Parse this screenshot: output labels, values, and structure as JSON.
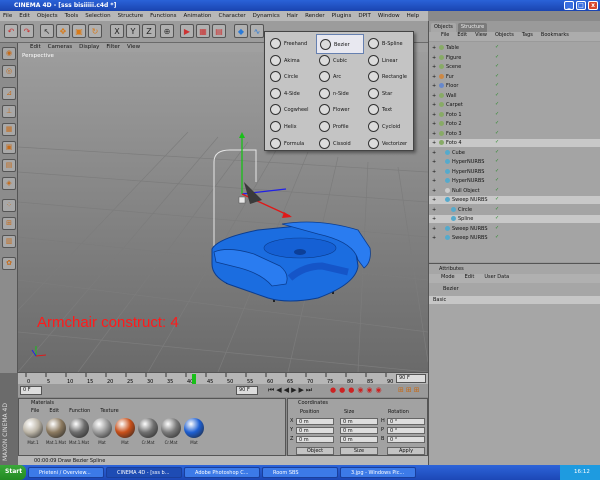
{
  "window": {
    "title": "CINEMA 4D - [sss bisiiiii.c4d *]"
  },
  "menu": [
    "File",
    "Edit",
    "Objects",
    "Tools",
    "Selection",
    "Structure",
    "Functions",
    "Animation",
    "Character",
    "Dynamics",
    "Hair",
    "Render",
    "Plugins",
    "DPIT",
    "Window",
    "Help"
  ],
  "viewport": {
    "menu": [
      "Edit",
      "Cameras",
      "Display",
      "Filter",
      "View"
    ],
    "label": "Perspective",
    "annotation": "Armchair construct: 4"
  },
  "spline_menu": [
    {
      "label": "Freehand",
      "sel": false
    },
    {
      "label": "Bezier",
      "sel": true
    },
    {
      "label": "B-Spline",
      "sel": false
    },
    {
      "label": "Akima",
      "sel": false
    },
    {
      "label": "Cubic",
      "sel": false
    },
    {
      "label": "Linear",
      "sel": false
    },
    {
      "label": "Circle",
      "sel": false
    },
    {
      "label": "Arc",
      "sel": false
    },
    {
      "label": "Rectangle",
      "sel": false
    },
    {
      "label": "4-Side",
      "sel": false
    },
    {
      "label": "n-Side",
      "sel": false
    },
    {
      "label": "Star",
      "sel": false
    },
    {
      "label": "Cogwheel",
      "sel": false
    },
    {
      "label": "Flower",
      "sel": false
    },
    {
      "label": "Text",
      "sel": false
    },
    {
      "label": "Helix",
      "sel": false
    },
    {
      "label": "Profile",
      "sel": false
    },
    {
      "label": "Cycloid",
      "sel": false
    },
    {
      "label": "Formula",
      "sel": false
    },
    {
      "label": "Cissoid",
      "sel": false
    },
    {
      "label": "Vectorizer",
      "sel": false
    }
  ],
  "timeline": {
    "ticks": [
      "0",
      "5",
      "10",
      "15",
      "20",
      "25",
      "30",
      "35",
      "40",
      "45",
      "50",
      "55",
      "60",
      "65",
      "70",
      "75",
      "80",
      "85",
      "90"
    ],
    "end_frame": "90 F",
    "current": "0 F",
    "max": "90 F"
  },
  "materials": {
    "title": "Materials",
    "menu": [
      "File",
      "Edit",
      "Function",
      "Texture"
    ],
    "items": [
      {
        "label": "Mat.1",
        "color": "#bdb6a8"
      },
      {
        "label": "Mat.1.Mat",
        "color": "#8c7a60"
      },
      {
        "label": "Mat.1.Mat",
        "color": "#6d6d6d"
      },
      {
        "label": "Mat",
        "color": "#9a9a9a"
      },
      {
        "label": "Mat",
        "color": "#c8501a"
      },
      {
        "label": "Cr.Mat",
        "color": "#707070"
      },
      {
        "label": "Cr.Mat",
        "color": "#7a7a7a"
      },
      {
        "label": "Mat",
        "color": "#1e5fd2"
      }
    ]
  },
  "coordinates": {
    "title": "Coordinates",
    "headers": [
      "Position",
      "Size",
      "Rotation"
    ],
    "rows": [
      {
        "axis": "X",
        "pos": "0 m",
        "size": "0 m",
        "rot_axis": "H",
        "rot": "0 °"
      },
      {
        "axis": "Y",
        "pos": "0 m",
        "size": "0 m",
        "rot_axis": "P",
        "rot": "0 °"
      },
      {
        "axis": "Z",
        "pos": "0 m",
        "size": "0 m",
        "rot_axis": "B",
        "rot": "0 °"
      }
    ],
    "mode1": "Object",
    "mode2": "Size",
    "apply": "Apply"
  },
  "status": {
    "text": "00:00:09    Draw Bezier Spline"
  },
  "maxon": "MAXON CINEMA 4D",
  "objects": {
    "tabs": [
      "Objects",
      "Structure"
    ],
    "menu": [
      "File",
      "Edit",
      "View",
      "Objects",
      "Tags",
      "Bookmarks"
    ],
    "rows": [
      {
        "name": "Table",
        "indent": 0,
        "dot": "#88aa66"
      },
      {
        "name": "Figure",
        "indent": 0,
        "dot": "#88aa66"
      },
      {
        "name": "Scene",
        "indent": 0,
        "dot": "#88aa66"
      },
      {
        "name": "Fur",
        "indent": 0,
        "dot": "#cc8844"
      },
      {
        "name": "Floor",
        "indent": 0,
        "dot": "#6688cc"
      },
      {
        "name": "Wall",
        "indent": 0,
        "dot": "#88aa66"
      },
      {
        "name": "Carpet",
        "indent": 0,
        "dot": "#88aa66"
      },
      {
        "name": "Foto 1",
        "indent": 0,
        "dot": "#88aa66"
      },
      {
        "name": "Foto 2",
        "indent": 0,
        "dot": "#88aa66"
      },
      {
        "name": "Foto 3",
        "indent": 0,
        "dot": "#88aa66"
      },
      {
        "name": "Foto 4",
        "indent": 0,
        "dot": "#88aa66",
        "sel": true
      },
      {
        "name": "Cube",
        "indent": 1,
        "dot": "#55aacc"
      },
      {
        "name": "HyperNURBS",
        "indent": 1,
        "dot": "#55aacc"
      },
      {
        "name": "HyperNURBS",
        "indent": 1,
        "dot": "#55aacc"
      },
      {
        "name": "HyperNURBS",
        "indent": 1,
        "dot": "#55aacc"
      },
      {
        "name": "Null Object",
        "indent": 1,
        "dot": "#cccccc"
      },
      {
        "name": "Sweep NURBS",
        "indent": 1,
        "dot": "#55aacc",
        "sel": true
      },
      {
        "name": "Circle",
        "indent": 2,
        "dot": "#55aacc"
      },
      {
        "name": "Spline",
        "indent": 2,
        "dot": "#55aacc",
        "sel": true
      },
      {
        "name": "Sweep NURBS",
        "indent": 1,
        "dot": "#55aacc"
      },
      {
        "name": "Sweep NURBS",
        "indent": 1,
        "dot": "#55aacc"
      }
    ]
  },
  "attributes": {
    "title": "Attributes",
    "menu": [
      "Mode",
      "Edit",
      "User Data"
    ],
    "object": "Bezier",
    "section": "Basic"
  },
  "taskbar": {
    "start": "Start",
    "tasks": [
      {
        "label": "Prieteni / Overview...",
        "active": false
      },
      {
        "label": "CINEMA 4D - [sss b...",
        "active": true
      },
      {
        "label": "Adobe Photoshop C...",
        "active": false
      },
      {
        "label": "Room SBS",
        "active": false
      },
      {
        "label": "3.jpg - Windows Pic...",
        "active": false
      }
    ],
    "clock": "16:12"
  }
}
